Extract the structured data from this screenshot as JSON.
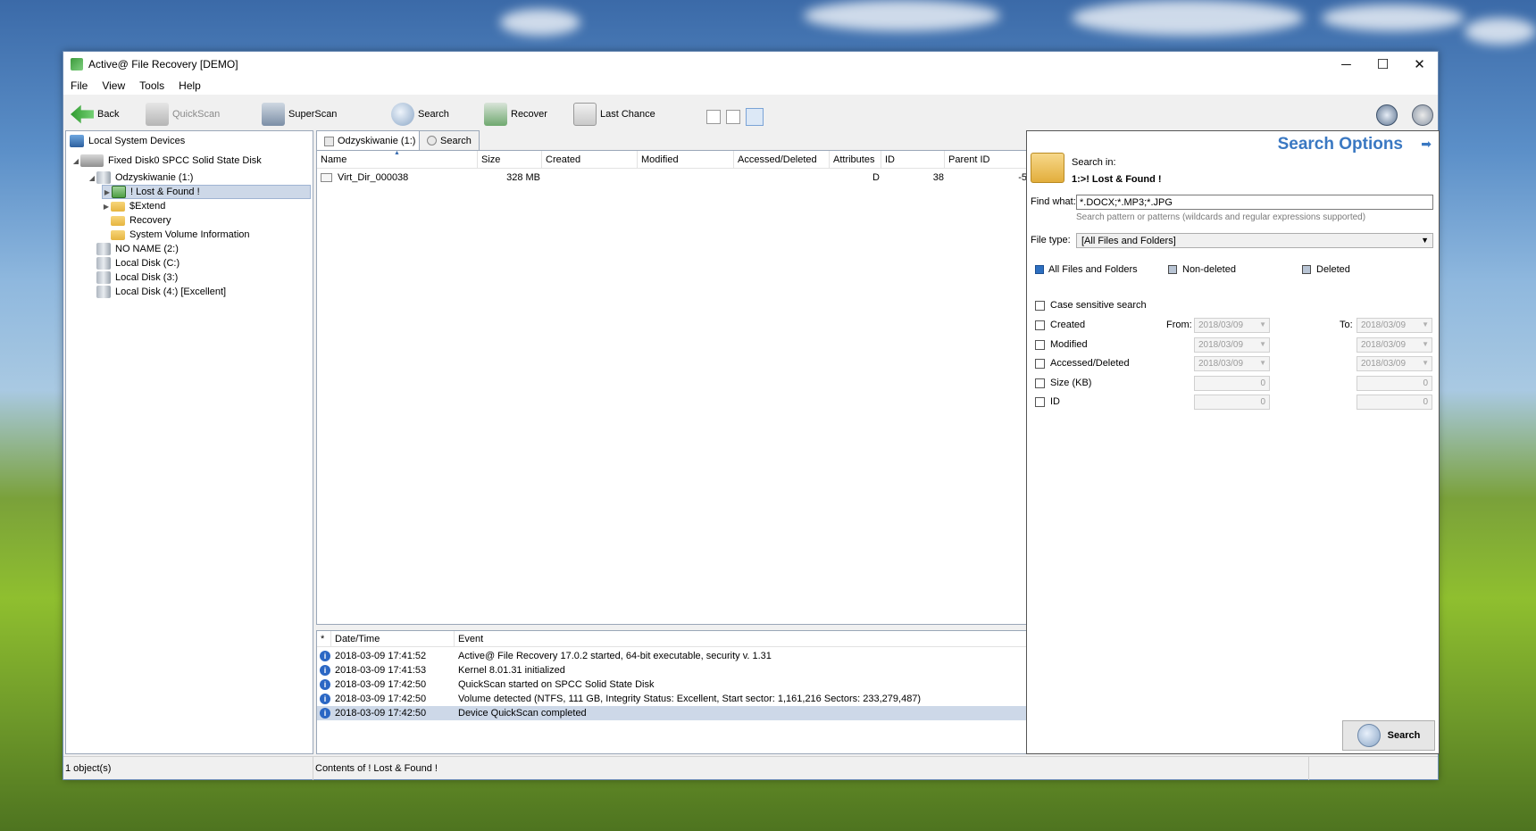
{
  "window": {
    "title": "Active@ File Recovery [DEMO]",
    "minimize_glyph": "─",
    "maximize_glyph": "☐",
    "close_glyph": "✕"
  },
  "menu": [
    "File",
    "View",
    "Tools",
    "Help"
  ],
  "toolbar": {
    "back": "Back",
    "quickscan": "QuickScan",
    "superscan": "SuperScan",
    "search": "Search",
    "recover": "Recover",
    "last_chance": "Last Chance"
  },
  "tree": {
    "root": "Local System Devices",
    "disk": "Fixed Disk0 SPCC Solid State Disk",
    "volume": "Odzyskiwanie (1:)",
    "lost_found": "! Lost & Found !",
    "extend": "$Extend",
    "recovery": "Recovery",
    "svi": "System Volume Information",
    "noname": "NO NAME (2:)",
    "local_c": "Local Disk (C:)",
    "local_3": "Local Disk (3:)",
    "local_4": "Local Disk (4:) [Excellent]",
    "expand_glyph": "▶",
    "collapse_glyph": "◢"
  },
  "tabs": {
    "contents": "Odzyskiwanie (1:)",
    "search": "Search"
  },
  "file_list": {
    "columns": [
      "Name",
      "Size",
      "Created",
      "Modified",
      "Accessed/Deleted",
      "Attributes",
      "ID",
      "Parent ID"
    ],
    "sort_glyph": "▲",
    "rows": [
      {
        "name": "Virt_Dir_000038",
        "size": "328 MB",
        "attributes": "D",
        "id": "38",
        "parent_id": "-5"
      }
    ]
  },
  "log": {
    "columns": [
      "*",
      "Date/Time",
      "Event"
    ],
    "rows": [
      {
        "time": "2018-03-09 17:41:52",
        "event": "Active@ File Recovery 17.0.2 started, 64-bit executable, security v. 1.31"
      },
      {
        "time": "2018-03-09 17:41:53",
        "event": "Kernel 8.01.31 initialized"
      },
      {
        "time": "2018-03-09 17:42:50",
        "event": "QuickScan started on SPCC Solid State Disk"
      },
      {
        "time": "2018-03-09 17:42:50",
        "event": "Volume detected (NTFS, 111 GB, Integrity Status: Excellent, Start sector: 1,161,216 Sectors: 233,279,487)"
      },
      {
        "time": "2018-03-09 17:42:50",
        "event": "Device QuickScan completed"
      }
    ]
  },
  "search_options": {
    "title": "Search Options",
    "arrow_glyph": "➡",
    "search_in_label": "Search in:",
    "search_in_value": "1:>! Lost & Found !",
    "find_what_label": "Find what:",
    "find_what_value": "*.DOCX;*.MP3;*.JPG",
    "find_hint": "Search pattern or patterns (wildcards and regular expressions supported)",
    "file_type_label": "File type:",
    "file_type_value": "[All Files and Folders]",
    "dropdown_glyph": "▼",
    "filter_all": "All Files and Folders",
    "filter_nondeleted": "Non-deleted",
    "filter_deleted": "Deleted",
    "case_sensitive": "Case sensitive search",
    "created": "Created",
    "modified": "Modified",
    "accessed": "Accessed/Deleted",
    "size": "Size (KB)",
    "id": "ID",
    "from_label": "From:",
    "to_label": "To:",
    "date_value": "2018/03/09",
    "zero": "0",
    "search_button": "Search"
  },
  "status": {
    "objects": "1 object(s)",
    "contents": "Contents of ! Lost & Found !"
  },
  "colors": {
    "accent": "#3a78c2",
    "selection": "#cdd8e8",
    "info_icon": "#2b67c4"
  }
}
